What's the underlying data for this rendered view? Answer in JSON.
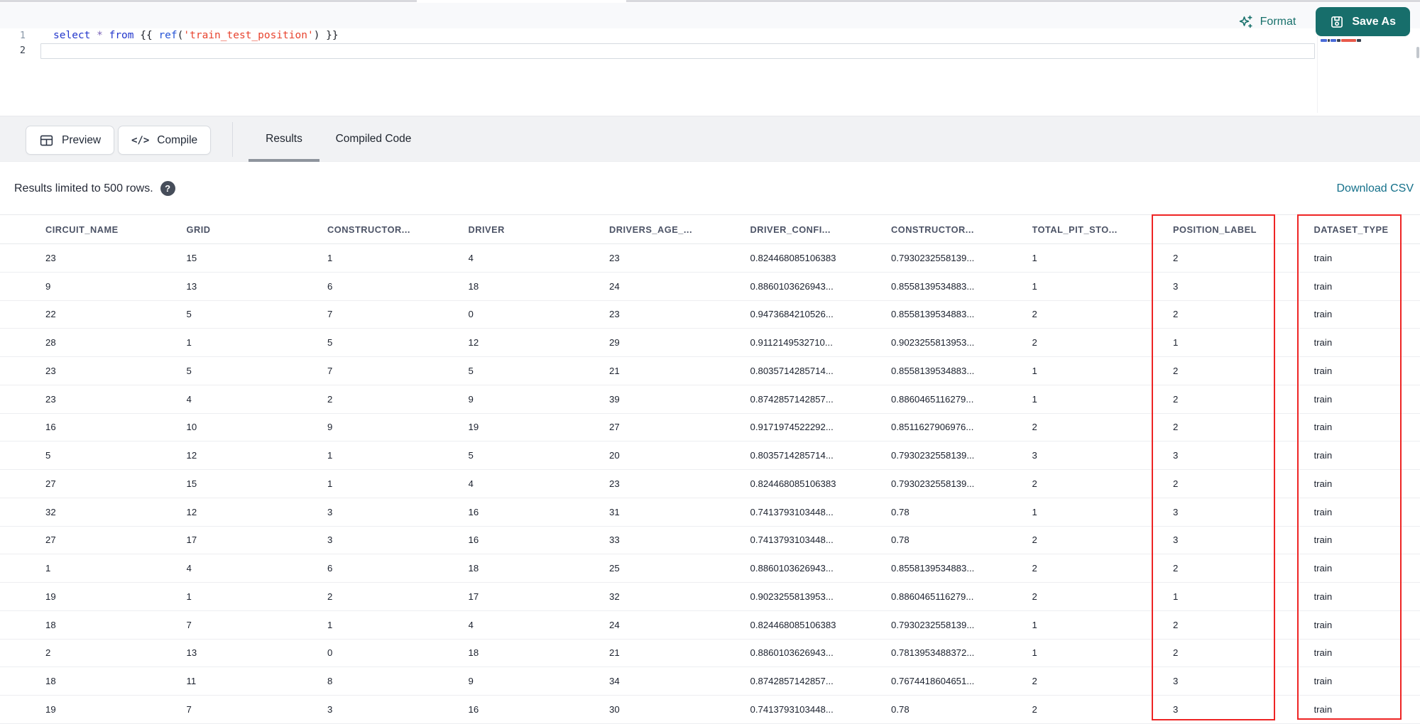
{
  "editor": {
    "line_numbers": [
      "1",
      "2"
    ],
    "tokens": [
      {
        "t": "select",
        "c": "kw"
      },
      {
        "t": " ",
        "c": "plain"
      },
      {
        "t": "*",
        "c": "op"
      },
      {
        "t": " ",
        "c": "plain"
      },
      {
        "t": "from",
        "c": "kw"
      },
      {
        "t": " {{ ",
        "c": "plain"
      },
      {
        "t": "ref",
        "c": "fn"
      },
      {
        "t": "(",
        "c": "plain"
      },
      {
        "t": "'train_test_position'",
        "c": "str"
      },
      {
        "t": ")",
        "c": "plain"
      },
      {
        "t": " }}",
        "c": "plain"
      }
    ],
    "format_label": "Format",
    "save_as_label": "Save As"
  },
  "toolbar": {
    "preview_label": "Preview",
    "compile_label": "Compile",
    "compile_glyph": "</>",
    "tabs": [
      {
        "label": "Results",
        "active": true
      },
      {
        "label": "Compiled Code",
        "active": false
      }
    ]
  },
  "results_bar": {
    "info_text": "Results limited to 500 rows.",
    "help_glyph": "?",
    "download_link": "Download CSV"
  },
  "table": {
    "headers": [
      "CIRCUIT_NAME",
      "GRID",
      "CONSTRUCTOR...",
      "DRIVER",
      "DRIVERS_AGE_...",
      "DRIVER_CONFI...",
      "CONSTRUCTOR...",
      "TOTAL_PIT_STO...",
      "POSITION_LABEL",
      "DATASET_TYPE"
    ],
    "highlighted_columns": [
      "POSITION_LABEL",
      "DATASET_TYPE"
    ],
    "rows": [
      [
        "23",
        "15",
        "1",
        "4",
        "23",
        "0.824468085106383",
        "0.7930232558139...",
        "1",
        "2",
        "train"
      ],
      [
        "9",
        "13",
        "6",
        "18",
        "24",
        "0.8860103626943...",
        "0.8558139534883...",
        "1",
        "3",
        "train"
      ],
      [
        "22",
        "5",
        "7",
        "0",
        "23",
        "0.9473684210526...",
        "0.8558139534883...",
        "2",
        "2",
        "train"
      ],
      [
        "28",
        "1",
        "5",
        "12",
        "29",
        "0.9112149532710...",
        "0.9023255813953...",
        "2",
        "1",
        "train"
      ],
      [
        "23",
        "5",
        "7",
        "5",
        "21",
        "0.8035714285714...",
        "0.8558139534883...",
        "1",
        "2",
        "train"
      ],
      [
        "23",
        "4",
        "2",
        "9",
        "39",
        "0.8742857142857...",
        "0.8860465116279...",
        "1",
        "2",
        "train"
      ],
      [
        "16",
        "10",
        "9",
        "19",
        "27",
        "0.9171974522292...",
        "0.8511627906976...",
        "2",
        "2",
        "train"
      ],
      [
        "5",
        "12",
        "1",
        "5",
        "20",
        "0.8035714285714...",
        "0.7930232558139...",
        "3",
        "3",
        "train"
      ],
      [
        "27",
        "15",
        "1",
        "4",
        "23",
        "0.824468085106383",
        "0.7930232558139...",
        "2",
        "2",
        "train"
      ],
      [
        "32",
        "12",
        "3",
        "16",
        "31",
        "0.7413793103448...",
        "0.78",
        "1",
        "3",
        "train"
      ],
      [
        "27",
        "17",
        "3",
        "16",
        "33",
        "0.7413793103448...",
        "0.78",
        "2",
        "3",
        "train"
      ],
      [
        "1",
        "4",
        "6",
        "18",
        "25",
        "0.8860103626943...",
        "0.8558139534883...",
        "2",
        "2",
        "train"
      ],
      [
        "19",
        "1",
        "2",
        "17",
        "32",
        "0.9023255813953...",
        "0.8860465116279...",
        "2",
        "1",
        "train"
      ],
      [
        "18",
        "7",
        "1",
        "4",
        "24",
        "0.824468085106383",
        "0.7930232558139...",
        "1",
        "2",
        "train"
      ],
      [
        "2",
        "13",
        "0",
        "18",
        "21",
        "0.8860103626943...",
        "0.7813953488372...",
        "1",
        "2",
        "train"
      ],
      [
        "18",
        "11",
        "8",
        "9",
        "34",
        "0.8742857142857...",
        "0.7674418604651...",
        "2",
        "3",
        "train"
      ],
      [
        "19",
        "7",
        "3",
        "16",
        "30",
        "0.7413793103448...",
        "0.78",
        "2",
        "3",
        "train"
      ]
    ]
  },
  "colors": {
    "accent_teal": "#176e6b",
    "link_teal": "#14708a",
    "annotation_red": "#ee2424",
    "keyword_blue": "#2337cc",
    "string_red": "#e8432e",
    "toolbar_gray": "#f1f2f4"
  }
}
